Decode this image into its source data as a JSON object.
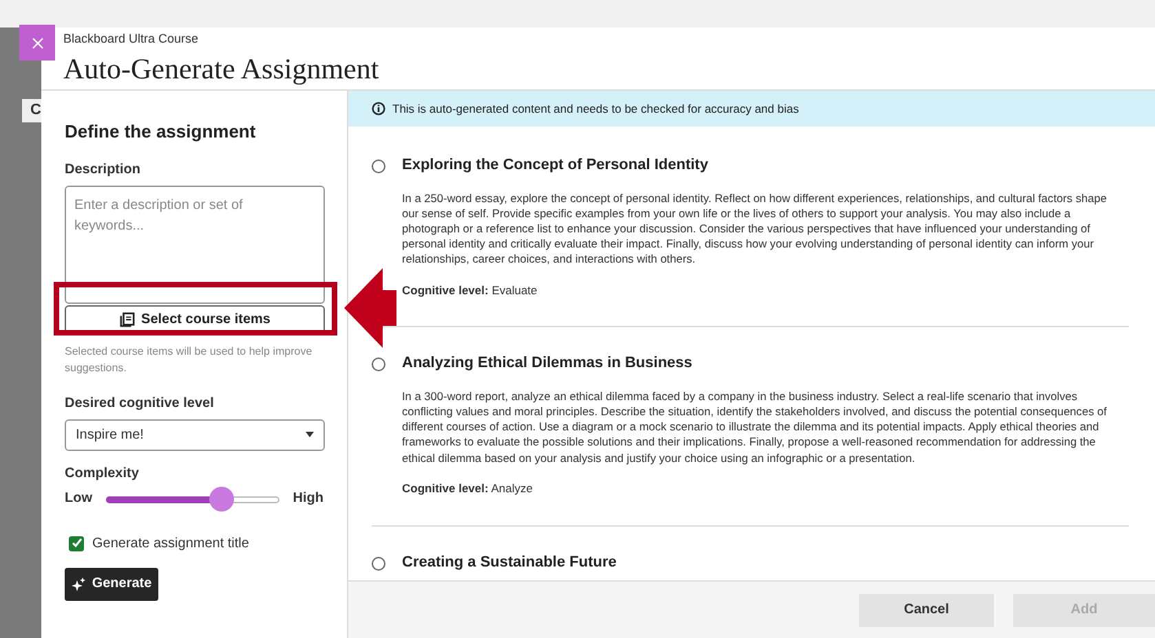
{
  "background_tab": "C",
  "header": {
    "course": "Blackboard Ultra Course",
    "title": "Auto-Generate Assignment"
  },
  "form": {
    "heading": "Define the assignment",
    "description": {
      "label": "Description",
      "placeholder": "Enter a description or set of keywords..."
    },
    "course_items_button": "Select course items",
    "course_items_hint": "Selected course items will be used to help improve suggestions.",
    "cognitive_level": {
      "label": "Desired cognitive level",
      "value": "Inspire me!"
    },
    "complexity": {
      "label": "Complexity",
      "low": "Low",
      "high": "High",
      "level": 0.67
    },
    "generate_title": {
      "label": "Generate assignment title",
      "checked": true
    },
    "generate_button": "Generate"
  },
  "notice": "This is auto-generated content and needs to be checked for accuracy and bias",
  "suggestions": [
    {
      "title": "Exploring the Concept of Personal Identity",
      "selected": false,
      "body": "In a 250-word essay, explore the concept of personal identity. Reflect on how different experiences, relationships, and cultural factors shape our sense of self. Provide specific examples from your own life or the lives of others to support your analysis. You may also include a photograph or a reference list to enhance your discussion. Consider the various perspectives that have influenced your understanding of personal identity and critically evaluate their impact. Finally, discuss how your evolving understanding of personal identity can inform your relationships, career choices, and interactions with others.",
      "level_label": "Cognitive level:",
      "level": "Evaluate"
    },
    {
      "title": "Analyzing Ethical Dilemmas in Business",
      "selected": false,
      "body": "In a 300-word report, analyze an ethical dilemma faced by a company in the business industry. Select a real-life scenario that involves conflicting values and moral principles. Describe the situation, identify the stakeholders involved, and discuss the potential consequences of different courses of action. Use a diagram or a mock scenario to illustrate the dilemma and its potential impacts. Apply ethical theories and frameworks to evaluate the possible solutions and their implications. Finally, propose a well-reasoned recommendation for addressing the ethical dilemma based on your analysis and justify your choice using an infographic or a presentation.",
      "level_label": "Cognitive level:",
      "level": "Analyze"
    },
    {
      "title": "Creating a Sustainable Future",
      "selected": false
    }
  ],
  "footer": {
    "cancel": "Cancel",
    "add": {
      "label": "Add",
      "disabled": true
    }
  }
}
